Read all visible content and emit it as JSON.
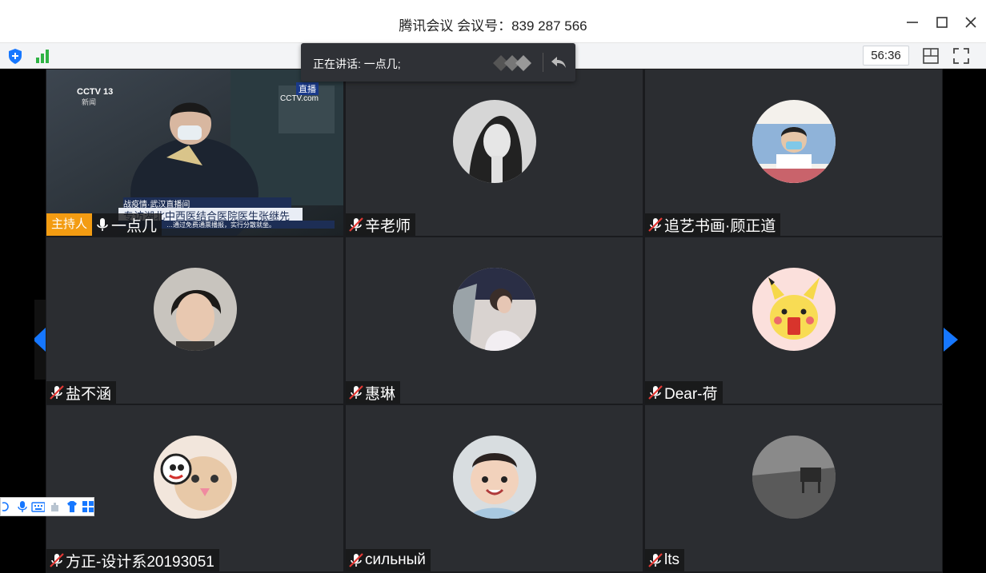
{
  "window": {
    "title": "腾讯会议 会议号：839 287 566"
  },
  "toolbar": {
    "timer": "56:36"
  },
  "speaking": {
    "text": "正在讲话: 一点几;"
  },
  "host": {
    "tag": "主持人"
  },
  "participants": [
    {
      "name": "一点几",
      "muted": false,
      "host": true,
      "video": true
    },
    {
      "name": "辛老师",
      "muted": true
    },
    {
      "name": "追艺书画·顾正道",
      "muted": true
    },
    {
      "name": "盐不涵",
      "muted": true
    },
    {
      "name": "惠琳",
      "muted": true
    },
    {
      "name": "Dear-荷",
      "muted": true
    },
    {
      "name": "方正-设计系20193051",
      "muted": true
    },
    {
      "name": "сильный",
      "muted": true
    },
    {
      "name": "lts",
      "muted": true
    }
  ],
  "video": {
    "channel": "CCTV 13",
    "channel_sub": "新闻",
    "live": "直播",
    "logo": "CCTV.com",
    "program": "战疫情·武汉直播间",
    "caption": "专访湖北中西医结合医院医生张继先",
    "ticker": "…通过免费通票播报，实行分散就坐。"
  },
  "colors": {
    "accent": "#1677ff",
    "host_tag": "#f39c12",
    "tile": "#2b2d31"
  }
}
